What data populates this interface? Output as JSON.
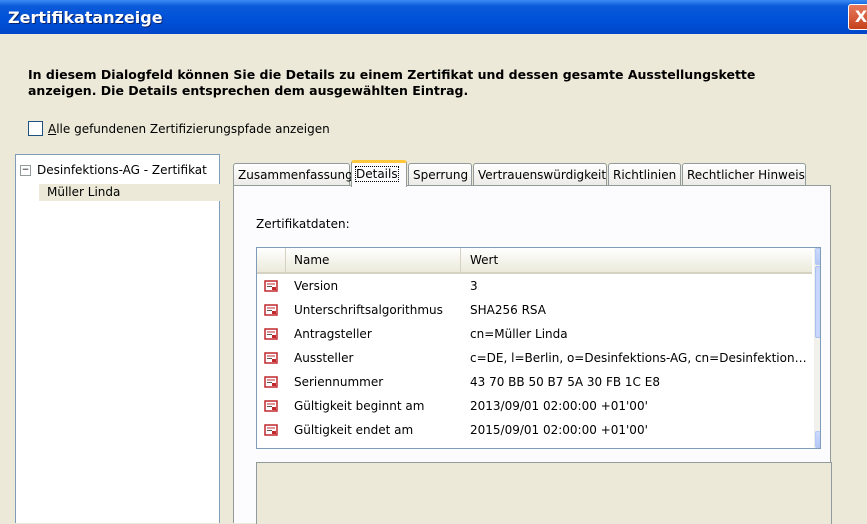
{
  "window": {
    "title": "Zertifikatanzeige",
    "close_glyph": "X"
  },
  "description": "In diesem Dialogfeld können Sie die Details zu einem Zertifikat und dessen gesamte Ausstellungskette anzeigen. Die Details entsprechen dem ausgewählten Eintrag.",
  "checkbox": {
    "label_accel": "A",
    "label_rest": "lle gefundenen Zertifizierungspfade anzeigen",
    "checked": false
  },
  "tree": {
    "toggle": "−",
    "root_label": "Desinfektions-AG - Zertifikat",
    "child_label": "Müller Linda"
  },
  "tabs": [
    "Zusammenfassung",
    "Details",
    "Sperrung",
    "Vertrauenswürdigkeit",
    "Richtlinien",
    "Rechtlicher Hinweis"
  ],
  "active_tab": "Details",
  "panel": {
    "data_label": "Zertifikatdaten:",
    "columns": {
      "name": "Name",
      "value": "Wert"
    },
    "rows": [
      {
        "name": "Version",
        "value": "3",
        "icon": "certificate-field-icon"
      },
      {
        "name": "Unterschriftsalgorithmus",
        "value": "SHA256 RSA",
        "icon": "certificate-field-icon"
      },
      {
        "name": "Antragsteller",
        "value": "cn=Müller Linda",
        "icon": "certificate-field-icon"
      },
      {
        "name": "Aussteller",
        "value": "c=DE, l=Berlin, o=Desinfektions-AG, cn=Desinfektions-…",
        "icon": "certificate-field-icon"
      },
      {
        "name": "Seriennummer",
        "value": "43 70 BB 50 B7 5A 30 FB 1C E8",
        "icon": "certificate-field-icon"
      },
      {
        "name": "Gültigkeit beginnt am",
        "value": "2013/09/01 02:00:00 +01'00'",
        "icon": "certificate-field-icon"
      },
      {
        "name": "Gültigkeit endet am",
        "value": "2015/09/01 02:00:00 +01'00'",
        "icon": "certificate-field-icon"
      }
    ],
    "scroll_up_glyph": "▲",
    "scroll_down_glyph": "▼"
  },
  "colors": {
    "titlebar": "#0050d8",
    "dialog_bg": "#ece9d8",
    "tab_highlight": "#ffc83c",
    "icon_red": "#c0282d"
  }
}
